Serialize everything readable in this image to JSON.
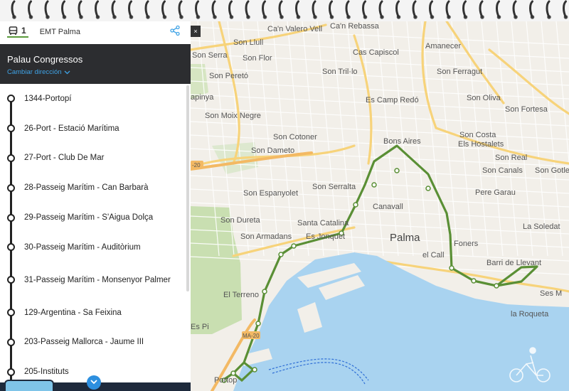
{
  "header": {
    "route_number": "1",
    "operator": "EMT Palma"
  },
  "destination": {
    "title": "Palau Congressos",
    "change_direction": "Cambiar dirección"
  },
  "stops": [
    {
      "label": "1344-Portopí"
    },
    {
      "label": "26-Port - Estació Marítima"
    },
    {
      "label": "27-Port - Club De Mar"
    },
    {
      "label": "28-Passeig Marítim - Can Barbarà"
    },
    {
      "label": "29-Passeig Marítim - S'Aigua Dolça"
    },
    {
      "label": "30-Passeig Marítim - Auditòrium"
    },
    {
      "label": "31-Passeig Marítim - Monsenyor Palmer"
    },
    {
      "label": "129-Argentina - Sa Feixina"
    },
    {
      "label": "203-Passeig Mallorca - Jaume III"
    },
    {
      "label": "205-Instituts"
    }
  ],
  "map": {
    "labels": {
      "can_valero": "Ca'n Valero Vell",
      "can_rebassa": "Ca'n Rebassa",
      "son_llull": "Son Llull",
      "son_serra": "Son Serra",
      "son_flor": "Son Flor",
      "cas_capiscol": "Cas Capiscol",
      "amanecer": "Amanecer",
      "son_peretó": "Son Peretó",
      "son_tril_lo": "Son Tril·lo",
      "son_ferragut": "Son Ferragut",
      "capinya": "apinya",
      "es_camp_redo": "Es Camp Redó",
      "son_oliva": "Son Oliva",
      "son_moix_negre": "Son Moix Negre",
      "son_fortesa": "Son Fortesa",
      "son_cotoner": "Son Cotoner",
      "son_costa": "Son Costa",
      "bons_aires": "Bons Aires",
      "els_hostalets": "Els Hostalets",
      "son_dameto": "Son Dameto",
      "son_real": "Son Real",
      "son_canals": "Son Canals",
      "son_gotleu": "Son Gotle",
      "son_espanyolet": "Son Espanyolet",
      "son_serralta": "Son Serralta",
      "pere_garau": "Pere Garau",
      "canavall": "Canavall",
      "son_dureta": "Son Dureta",
      "santa_catalina": "Santa Catalina",
      "palma": "Palma",
      "la_soledat": "La Soledat",
      "son_armadans": "Son Armadans",
      "es_jonquet": "Es Jonquet",
      "foners": "Foners",
      "el_call": "el Call",
      "barri_de_llevant": "Barri de Llevant",
      "el_terreno": "El Terreno",
      "ses_m": "Ses M",
      "la_roqueta": "la Roqueta",
      "es_pil": "Es Pi",
      "portop": "Portop",
      "road_20": "-20",
      "road_ma20b": "MA-20"
    },
    "route_color": "#5a8f35",
    "water_color": "#a9d3f0"
  }
}
